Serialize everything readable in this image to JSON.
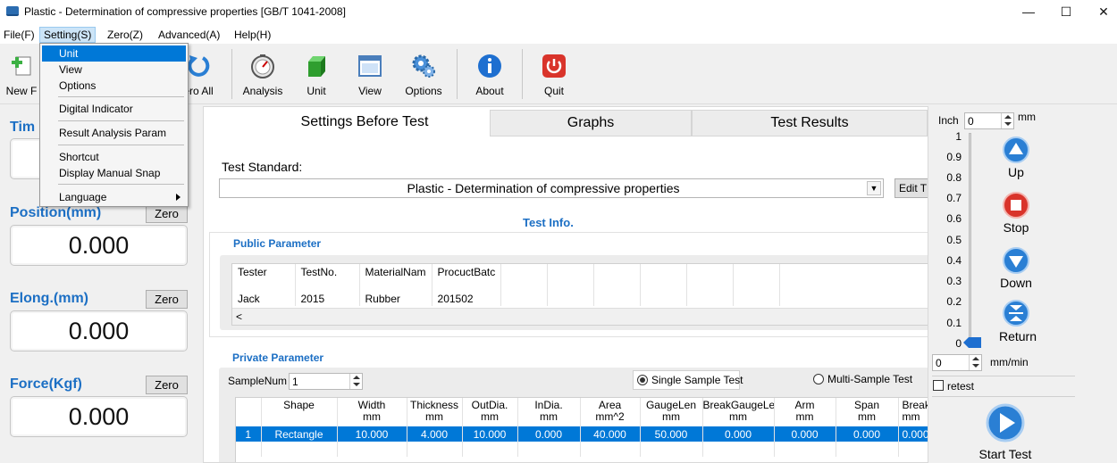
{
  "window": {
    "title": "Plastic - Determination of compressive properties [GB/T 1041-2008]",
    "controls": [
      "—",
      "☐",
      "✕"
    ]
  },
  "menubar": [
    "File(F)",
    "Setting(S)",
    "Zero(Z)",
    "Advanced(A)",
    "Help(H)"
  ],
  "toolbar": {
    "new_label": "New F",
    "zero_all_label": "ero All",
    "analysis_label": "Analysis",
    "unit_label": "Unit",
    "view_label": "View",
    "options_label": "Options",
    "about_label": "About",
    "quit_label": "Quit"
  },
  "setting_menu": {
    "unit": "Unit",
    "view": "View",
    "options": "Options",
    "digital_indicator": "Digital Indicator",
    "result_analysis": "Result Analysis Param",
    "shortcut": "Shortcut",
    "display_manual_snap": "Display Manual Snap",
    "language": "Language"
  },
  "left_panel": {
    "time_label": "Tim",
    "position_label": "Position(mm)",
    "position_value": "0.000",
    "elong_label": "Elong.(mm)",
    "elong_value": "0.000",
    "force_label": "Force(Kgf)",
    "force_value": "0.000",
    "zero_label": "Zero"
  },
  "tabs": [
    "Settings Before Test",
    "Graphs",
    "Test Results"
  ],
  "settings": {
    "test_standard_label": "Test Standard:",
    "test_standard_value": "Plastic - Determination of compressive properties",
    "edit_button": "Edit T",
    "test_info_title": "Test Info.",
    "public_param_title": "Public Parameter",
    "public_headers": [
      "Tester",
      "TestNo.",
      "MaterialNam",
      "ProcuctBatc"
    ],
    "public_values": [
      "Jack",
      "2015",
      "Rubber",
      "201502"
    ],
    "scroll_left": "<",
    "private_param_title": "Private Parameter",
    "sample_num_label": "SampleNum",
    "sample_num_value": "1",
    "single_sample": "Single Sample Test",
    "multi_sample": "Multi-Sample Test",
    "private_headers": [
      [
        "",
        ""
      ],
      [
        "Shape",
        ""
      ],
      [
        "Width",
        "mm"
      ],
      [
        "Thickness",
        "mm"
      ],
      [
        "OutDia.",
        "mm"
      ],
      [
        "InDia.",
        "mm"
      ],
      [
        "Area",
        "mm^2"
      ],
      [
        "GaugeLen",
        "mm"
      ],
      [
        "BreakGaugeLe",
        "mm"
      ],
      [
        "Arm",
        "mm"
      ],
      [
        "Span",
        "mm"
      ],
      [
        "Break",
        "mm"
      ]
    ],
    "private_row": [
      "1",
      "Rectangle",
      "10.000",
      "4.000",
      "10.000",
      "0.000",
      "40.000",
      "50.000",
      "0.000",
      "0.000",
      "0.000",
      "0.000"
    ]
  },
  "right_panel": {
    "inch_label": "Inch",
    "inch_value": "0",
    "mm_label": "mm",
    "scale": [
      "1",
      "0.9",
      "0.8",
      "0.7",
      "0.6",
      "0.5",
      "0.4",
      "0.3",
      "0.2",
      "0.1",
      "0"
    ],
    "up_label": "Up",
    "stop_label": "Stop",
    "down_label": "Down",
    "return_label": "Return",
    "speed_value": "0",
    "speed_unit": "mm/min",
    "retest_label": "retest",
    "start_label": "Start Test"
  },
  "colors": {
    "accent": "#1c6fc4",
    "selection": "#0078d7",
    "quit_red": "#d9342b"
  }
}
